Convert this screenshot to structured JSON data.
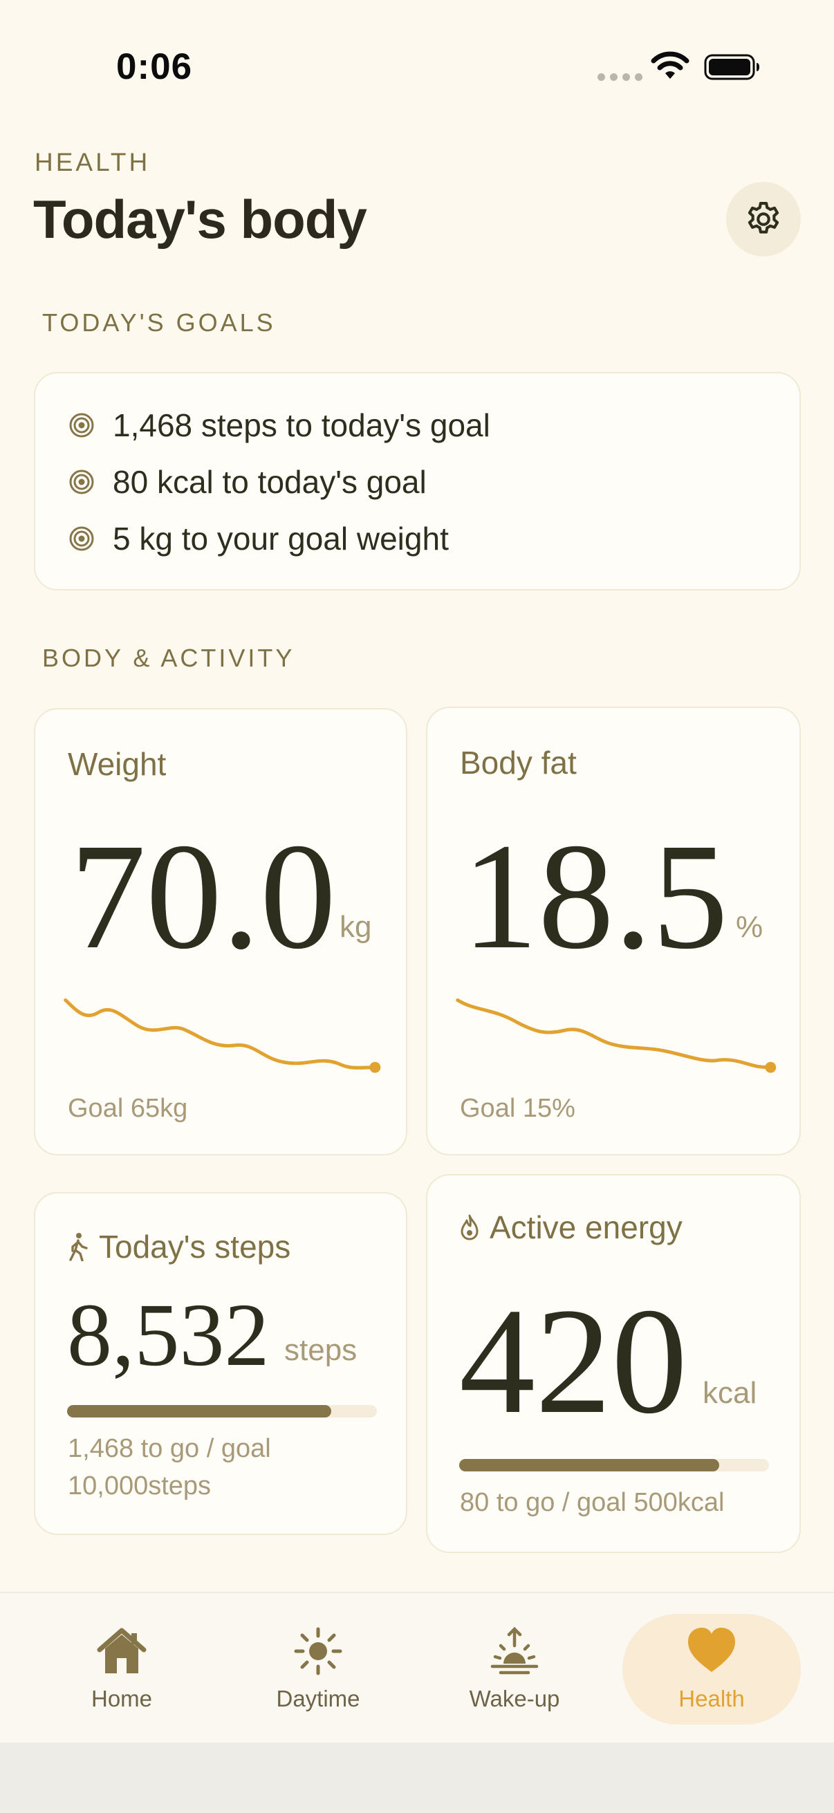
{
  "status_bar": {
    "time": "0:06"
  },
  "header": {
    "eyebrow": "HEALTH",
    "title": "Today's body"
  },
  "goals_section": {
    "label": "TODAY'S GOALS",
    "items": [
      "1,468 steps to today's goal",
      "80 kcal to today's goal",
      "5 kg to your goal weight"
    ]
  },
  "body_section": {
    "label": "BODY & ACTIVITY"
  },
  "weight": {
    "label": "Weight",
    "value": "70.0",
    "unit": "kg",
    "goal": "Goal 65kg"
  },
  "body_fat": {
    "label": "Body fat",
    "value": "18.5",
    "unit": "%",
    "goal": "Goal 15%"
  },
  "steps": {
    "label": "Today's steps",
    "value": "8,532",
    "unit": "steps",
    "progress": 0.853,
    "foot_line1": "1,468 to go / goal",
    "foot_line2": "10,000steps"
  },
  "energy": {
    "label": "Active energy",
    "value": "420",
    "unit": "kcal",
    "progress": 0.84,
    "foot": "80 to go / goal 500kcal"
  },
  "tabs": [
    {
      "label": "Home",
      "icon": "house-icon"
    },
    {
      "label": "Daytime",
      "icon": "sun-icon"
    },
    {
      "label": "Wake-up",
      "icon": "sunrise-icon"
    },
    {
      "label": "Health",
      "icon": "heart-icon",
      "active": true
    }
  ],
  "colors": {
    "background": "#fdf9ee",
    "accent": "#e1a22f",
    "olive": "#857549",
    "text": "#2e2e1f"
  }
}
